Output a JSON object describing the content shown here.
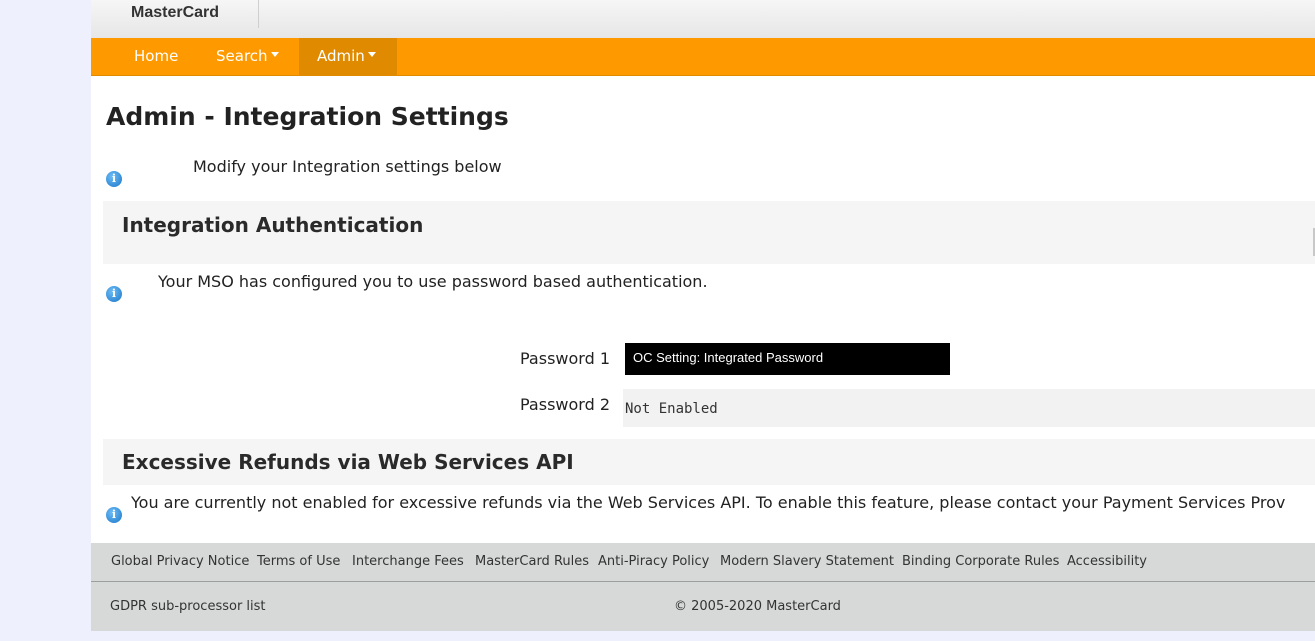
{
  "brand": {
    "name": "MasterCard"
  },
  "nav": {
    "items": [
      {
        "label": "Home",
        "has_caret": false
      },
      {
        "label": "Search",
        "has_caret": true
      },
      {
        "label": "Admin",
        "has_caret": true,
        "active": true
      }
    ],
    "colors": {
      "bar": "#ff9900",
      "active": "#e08a00"
    }
  },
  "page": {
    "title": "Admin - Integration Settings",
    "intro": "Modify your Integration settings below"
  },
  "integration_auth": {
    "title": "Integration Authentication",
    "message": "Your MSO has configured you to use password based authentication.",
    "password1": {
      "label": "Password 1",
      "value": "OC Setting: Integrated Password"
    },
    "password2": {
      "label": "Password 2",
      "value": "Not Enabled"
    }
  },
  "excessive_refunds": {
    "title": "Excessive Refunds via Web Services API",
    "message": "You are currently not enabled for excessive refunds via the Web Services API. To enable this feature, please contact your Payment Services Prov"
  },
  "footer": {
    "links": [
      "Global Privacy Notice",
      "Terms of Use",
      "Interchange Fees",
      "MasterCard Rules",
      "Anti-Piracy Policy",
      "Modern Slavery Statement",
      "Binding Corporate Rules",
      "Accessibility"
    ],
    "gdpr": "GDPR sub-processor list",
    "copyright": "© 2005-2020 MasterCard"
  },
  "icons": {
    "info": "info-icon"
  }
}
